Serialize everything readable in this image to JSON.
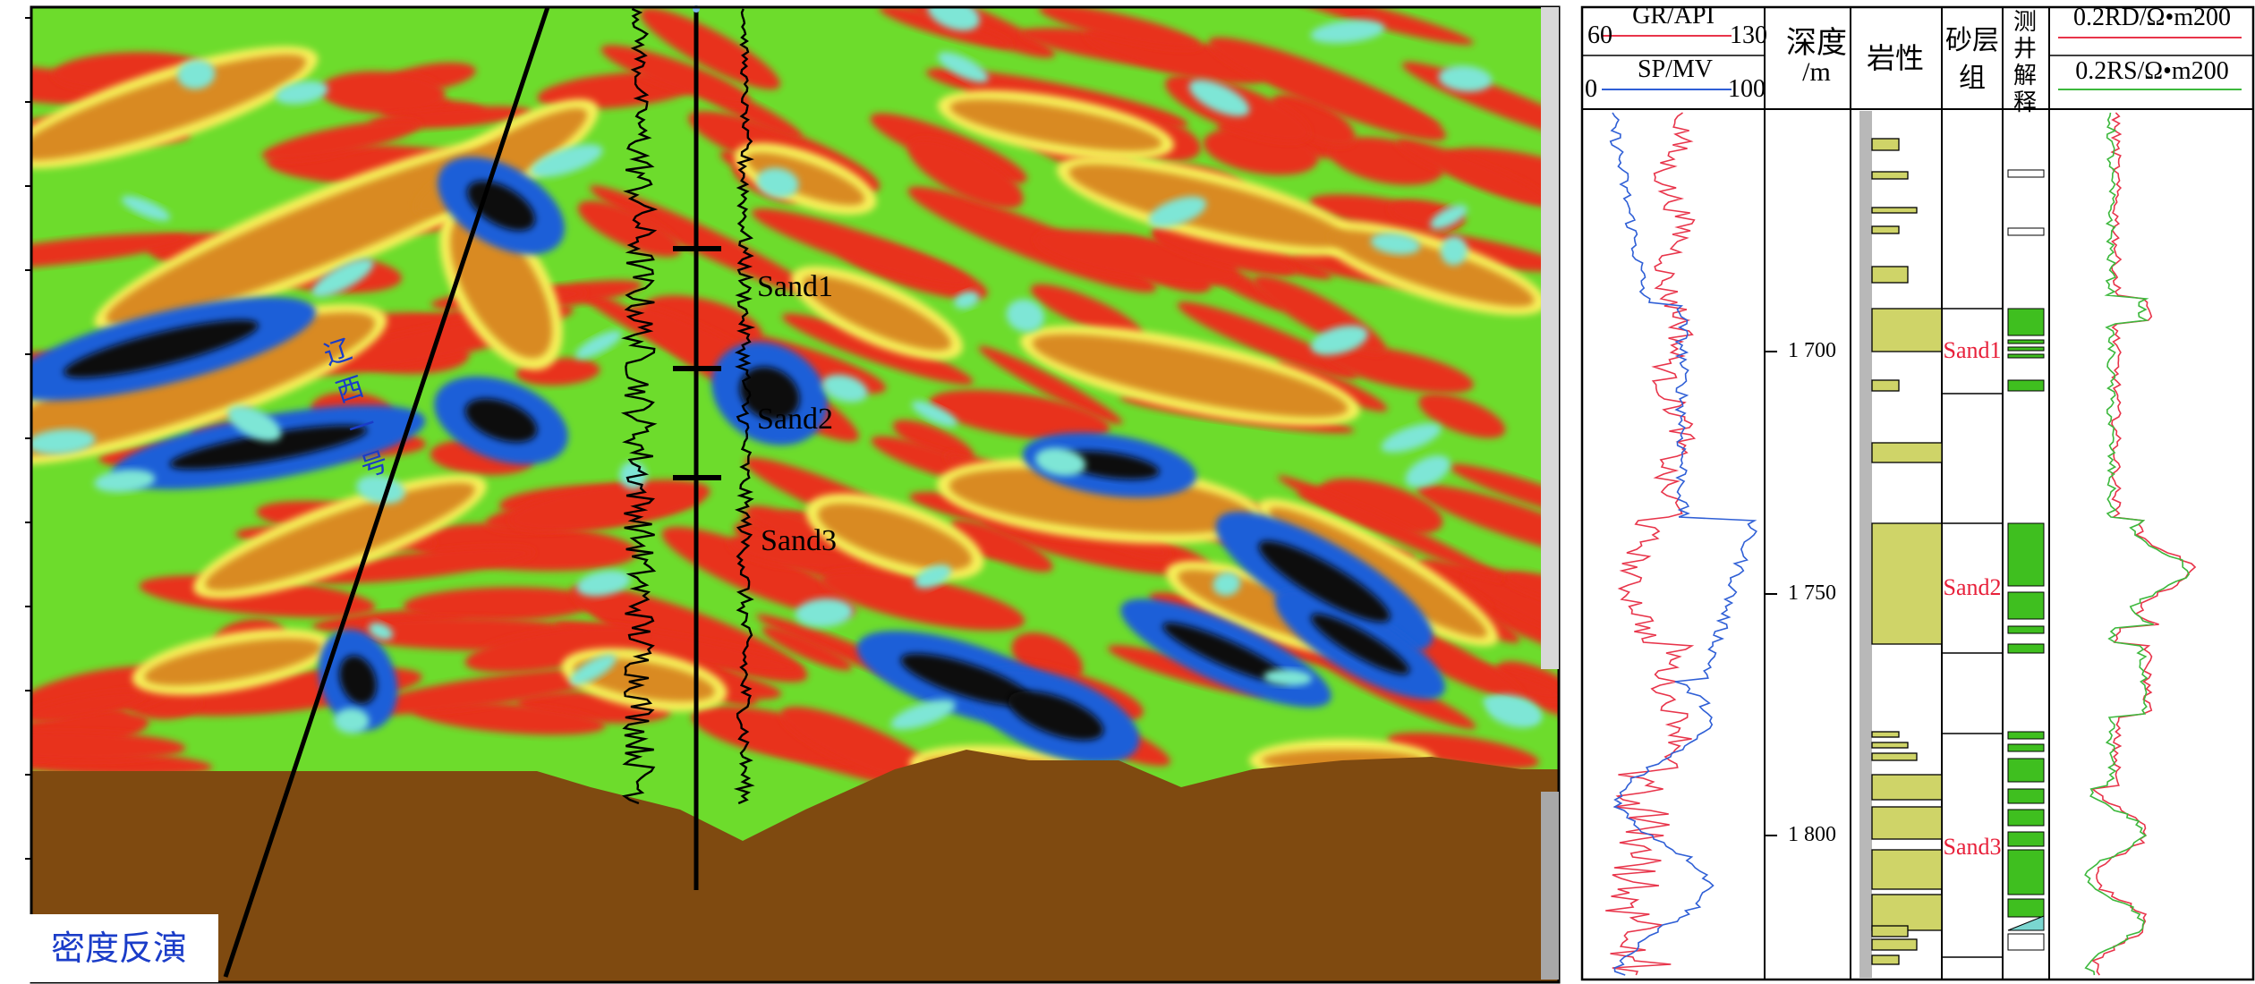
{
  "section": {
    "title": "密度反演",
    "fault_label": "辽西一号",
    "sand_labels": [
      "Sand1",
      "Sand2",
      "Sand3"
    ],
    "colors": {
      "background_brown": "#7f4a10",
      "red": "#e8321f",
      "green": "#6ddc2c",
      "yellow": "#f6f05a",
      "orange": "#d98a22",
      "blue": "#1e5fd8",
      "black": "#0a0a0a",
      "cyan": "#7ee6d6"
    }
  },
  "log_panel": {
    "headers": {
      "gr_label": "GR/API",
      "gr_min": "60",
      "gr_max": "130",
      "sp_label": "SP/MV",
      "sp_min": "0",
      "sp_max": "100",
      "depth_line1": "深度",
      "depth_line2": "/m",
      "lithology": "岩性",
      "sand_group_line1": "砂层",
      "sand_group_line2": "组",
      "interp_chars": [
        "测",
        "井",
        "解",
        "释"
      ],
      "rd_label": "0.2RD/Ω•m200",
      "rs_label": "0.2RS/Ω•m200"
    },
    "depth_ticks": [
      "1 700",
      "1 750",
      "1 800"
    ],
    "sand_groups": [
      "Sand1",
      "Sand2",
      "Sand3"
    ],
    "colors": {
      "gr_curve": "#e8344a",
      "sp_curve": "#2f5fd6",
      "rd_curve": "#e8344a",
      "rs_curve": "#3cb83c",
      "lithology_fill": "#cfd468",
      "interp_fill": "#3fbf1f",
      "sand_label": "#e8203a",
      "depth_bar": "#b8b8b8"
    }
  }
}
